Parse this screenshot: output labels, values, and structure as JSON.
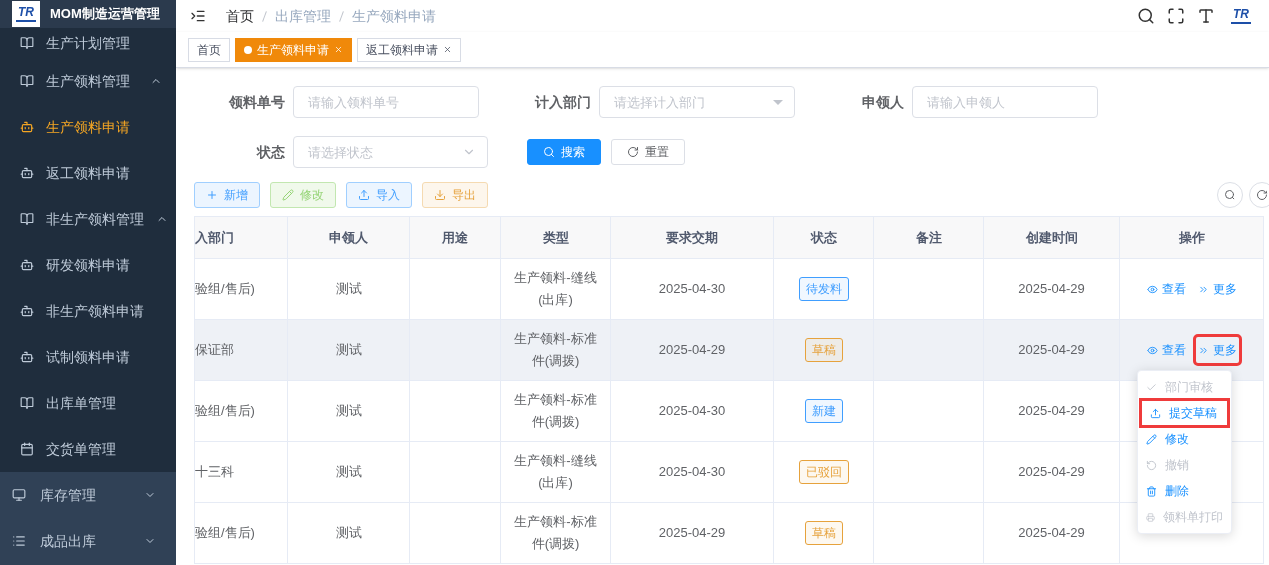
{
  "app": {
    "logo_text": "TR",
    "title": "MOM制造运营管理"
  },
  "sidebar": {
    "submenu": [
      {
        "label": "生产计划管理",
        "selected": false
      },
      {
        "label": "生产领料管理",
        "selected": false,
        "expanded": true,
        "children": [
          {
            "label": "生产领料申请",
            "selected": true
          },
          {
            "label": "返工领料申请",
            "selected": false
          }
        ]
      },
      {
        "label": "非生产领料管理",
        "selected": false,
        "expanded": true,
        "children": [
          {
            "label": "研发领料申请",
            "selected": false
          },
          {
            "label": "非生产领料申请",
            "selected": false
          },
          {
            "label": "试制领料申请",
            "selected": false
          }
        ]
      },
      {
        "label": "出库单管理",
        "selected": false
      },
      {
        "label": "交货单管理",
        "selected": false
      }
    ],
    "items": [
      {
        "label": "库存管理",
        "expanded": false
      },
      {
        "label": "成品出库",
        "expanded": false
      }
    ]
  },
  "breadcrumb": [
    "首页",
    "出库管理",
    "生产领料申请"
  ],
  "header_logo": "TR",
  "tabs": [
    {
      "label": "首页",
      "selected": false,
      "closable": false
    },
    {
      "label": "生产领料申请",
      "selected": true,
      "closable": true
    },
    {
      "label": "返工领料申请",
      "selected": false,
      "closable": true
    }
  ],
  "filters": [
    {
      "label": "领料单号",
      "kind": "input",
      "placeholder": "请输入领料单号"
    },
    {
      "label": "计入部门",
      "kind": "select",
      "placeholder": "请选择计入部门"
    },
    {
      "label": "申领人",
      "kind": "input",
      "placeholder": "请输入申领人"
    },
    {
      "label": "状态",
      "kind": "dropdown",
      "placeholder": "请选择状态"
    }
  ],
  "search_buttons": [
    {
      "label": "搜索",
      "kind": "primary"
    },
    {
      "label": "重置",
      "kind": "plain"
    }
  ],
  "toolbar": [
    {
      "label": "新增",
      "kind": "add"
    },
    {
      "label": "修改",
      "kind": "edit"
    },
    {
      "label": "导入",
      "kind": "import"
    },
    {
      "label": "导出",
      "kind": "export"
    }
  ],
  "table": {
    "columns": [
      "入部门",
      "申领人",
      "用途",
      "类型",
      "要求交期",
      "状态",
      "备注",
      "创建时间",
      "操作"
    ],
    "rows": [
      {
        "dept": "验组/售后)",
        "applicant": "测试",
        "type": "生产领料-缝线(出库)",
        "due": "2025-04-30",
        "status": {
          "label": "待发料",
          "color": "#409eff"
        },
        "created": "2025-04-29",
        "hovered": false,
        "actions": [
          {
            "label": "查看",
            "kind": "view",
            "annotated": false
          },
          {
            "label": "更多",
            "kind": "more",
            "annotated": false
          }
        ]
      },
      {
        "dept": "保证部",
        "applicant": "测试",
        "type": "生产领料-标准件(调拨)",
        "due": "2025-04-29",
        "status": {
          "label": "草稿",
          "color": "#e6a23c"
        },
        "created": "2025-04-29",
        "hovered": true,
        "actions": [
          {
            "label": "查看",
            "kind": "view",
            "annotated": false
          },
          {
            "label": "更多",
            "kind": "more",
            "annotated": true
          }
        ]
      },
      {
        "dept": "验组/售后)",
        "applicant": "测试",
        "type": "生产领料-标准件(调拨)",
        "due": "2025-04-30",
        "status": {
          "label": "新建",
          "color": "#409eff"
        },
        "created": "2025-04-29",
        "hovered": false
      },
      {
        "dept": "十三科",
        "applicant": "测试",
        "type": "生产领料-缝线(出库)",
        "due": "2025-04-30",
        "status": {
          "label": "已驳回",
          "color": "#e6a23c"
        },
        "created": "2025-04-29",
        "hovered": false
      },
      {
        "dept": "验组/售后)",
        "applicant": "测试",
        "type": "生产领料-标准件(调拨)",
        "due": "2025-04-29",
        "status": {
          "label": "草稿",
          "color": "#e6a23c"
        },
        "created": "2025-04-29",
        "hovered": false
      }
    ]
  },
  "more_menu": [
    {
      "label": "部门审核",
      "disabled": true,
      "annotated": false
    },
    {
      "label": "提交草稿",
      "disabled": false,
      "annotated": true
    },
    {
      "label": "修改",
      "disabled": false,
      "annotated": false
    },
    {
      "label": "撤销",
      "disabled": true,
      "annotated": false
    },
    {
      "label": "删除",
      "disabled": false,
      "annotated": false
    },
    {
      "label": "领料单打印",
      "disabled": true,
      "annotated": false
    }
  ]
}
